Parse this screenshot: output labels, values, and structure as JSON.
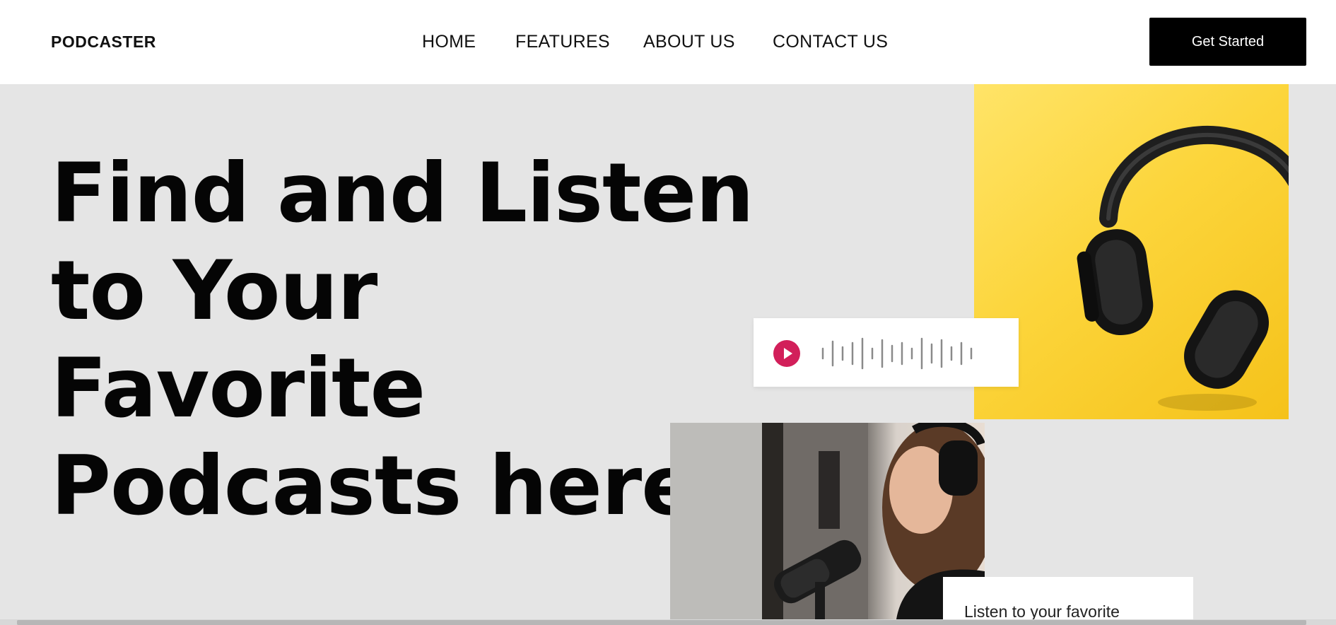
{
  "navbar": {
    "brand": "PODCASTER",
    "links": [
      {
        "label": "HOME"
      },
      {
        "label": "FEATURES"
      },
      {
        "label": "ABOUT US"
      },
      {
        "label": "CONTACT US"
      }
    ],
    "cta_label": "Get Started"
  },
  "hero": {
    "headline_lines": [
      "Find and Listen",
      "to Your",
      "Favorite",
      "Podcasts here!"
    ],
    "player": {
      "play_icon": "play-icon",
      "accent_color": "#d21f5a"
    },
    "info_card_text": "Listen to your favorite"
  },
  "colors": {
    "background": "#e5e5e5",
    "navbar_bg": "#ffffff",
    "cta_bg": "#000000",
    "headphones_bg": "#fcd53b"
  }
}
